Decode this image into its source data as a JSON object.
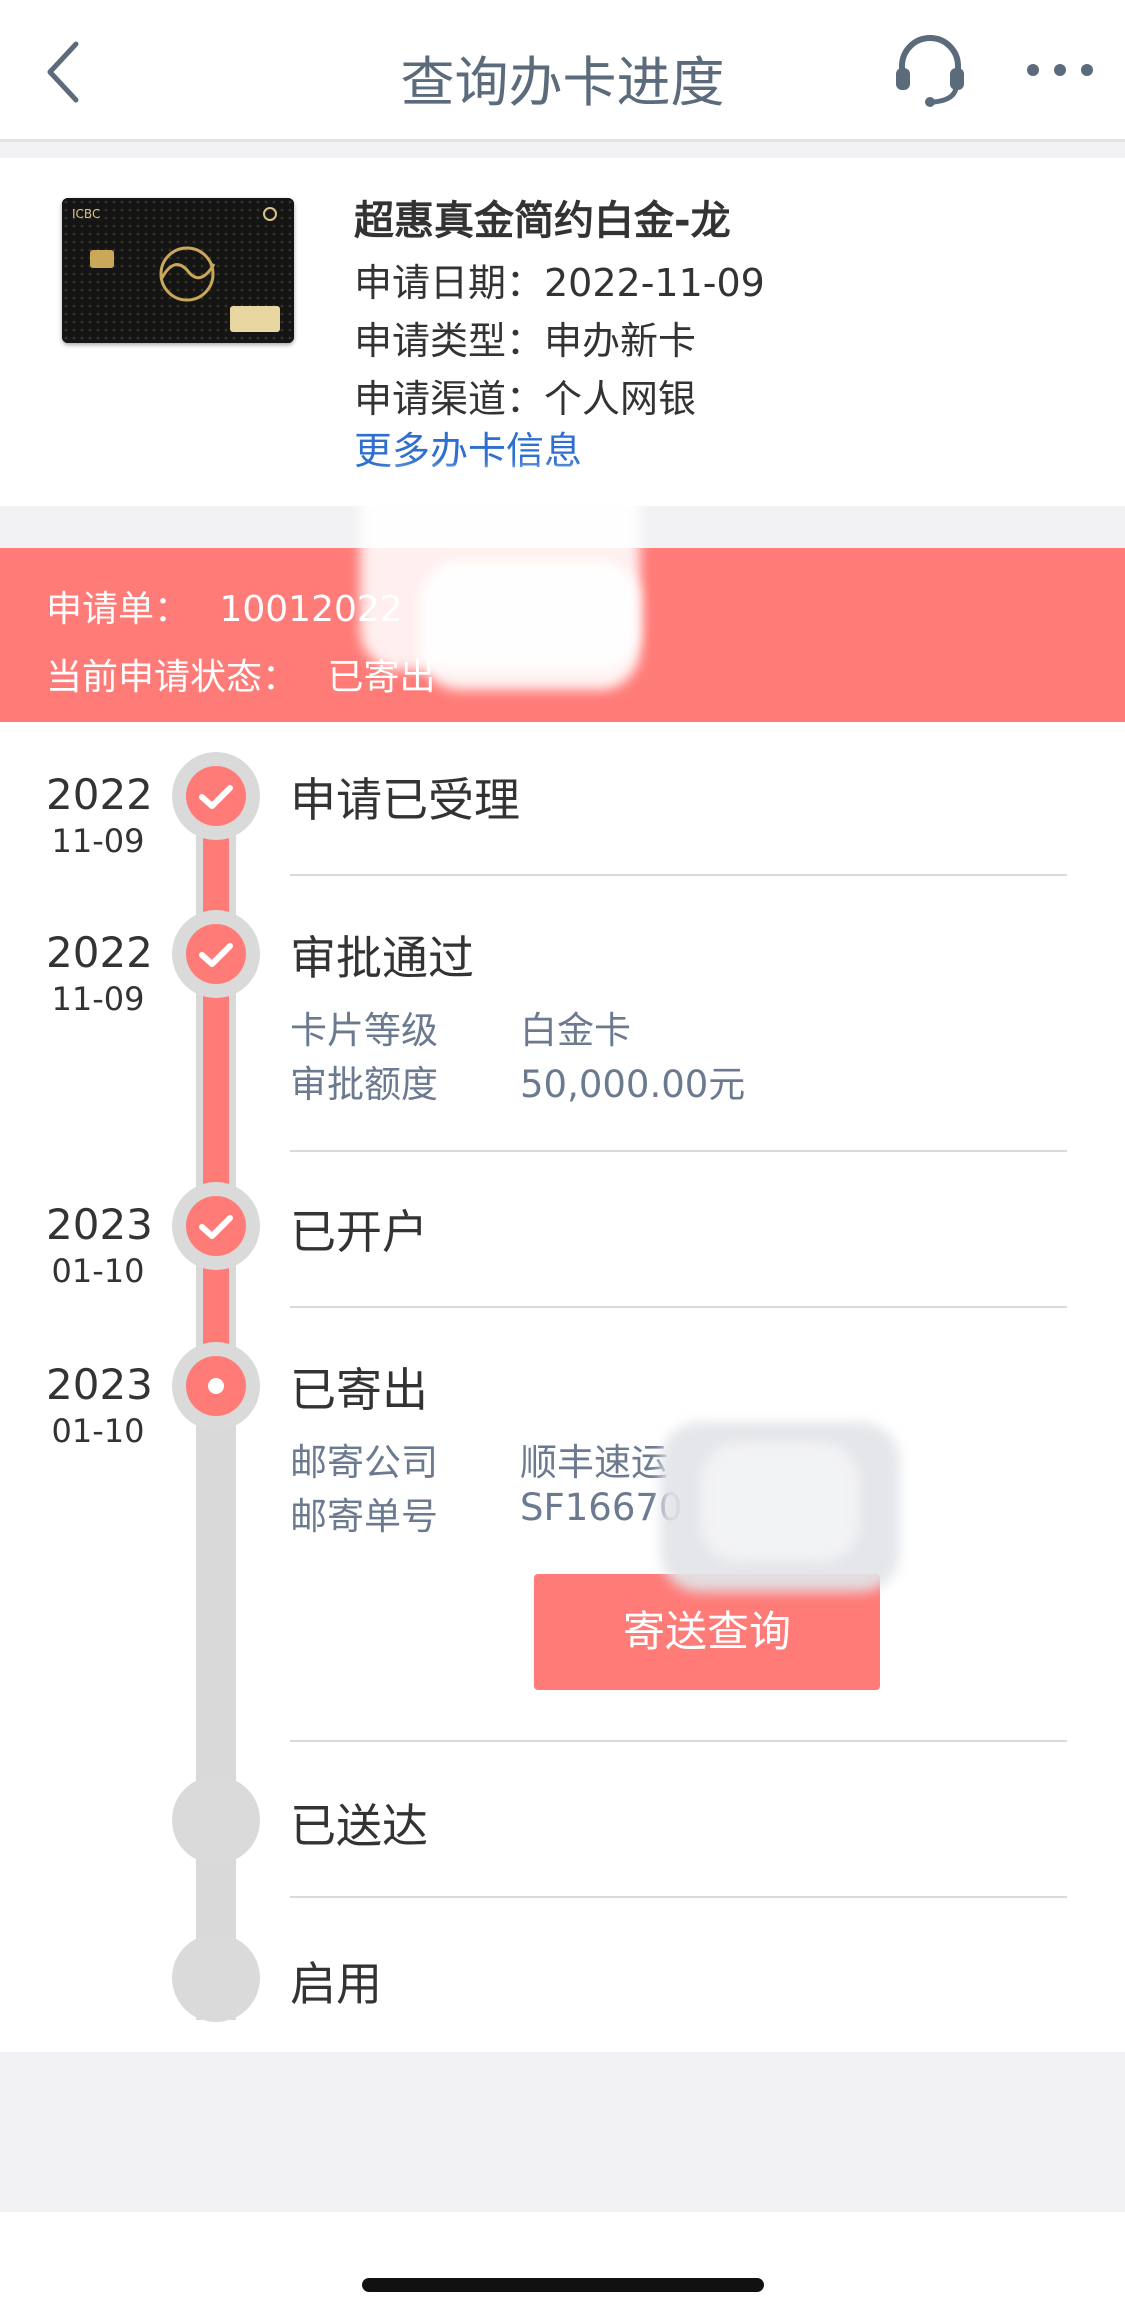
{
  "header": {
    "title": "查询办卡进度",
    "back_icon": "chevron-left-icon",
    "service_icon": "headset-icon",
    "more_icon": "more-dots-icon"
  },
  "card": {
    "name": "超惠真金简约白金-龙",
    "apply_date": "申请日期：2022-11-09",
    "apply_type": "申请类型：申办新卡",
    "apply_channel": "申请渠道：个人网银",
    "more_link": "更多办卡信息",
    "card_brand": "ICBC"
  },
  "banner": {
    "order_label": "申请单：",
    "order_value": "10012022",
    "status_label": "当前申请状态：",
    "status_value": "已寄出"
  },
  "timeline": {
    "steps": [
      {
        "year": "2022",
        "md": "11-09",
        "title": "申请已受理"
      },
      {
        "year": "2022",
        "md": "11-09",
        "title": "审批通过",
        "details": [
          {
            "label": "卡片等级",
            "value": "白金卡"
          },
          {
            "label": "审批额度",
            "value": "50,000.00元"
          }
        ]
      },
      {
        "year": "2023",
        "md": "01-10",
        "title": "已开户"
      },
      {
        "year": "2023",
        "md": "01-10",
        "title": "已寄出",
        "details": [
          {
            "label": "邮寄公司",
            "value": "顺丰速运"
          },
          {
            "label": "邮寄单号",
            "value": "SF16670"
          }
        ],
        "button": "寄送查询"
      },
      {
        "title": "已送达"
      },
      {
        "title": "启用"
      }
    ]
  },
  "colors": {
    "accent": "#ff7b78",
    "link": "#2e6fcf",
    "title": "#5b6b7c",
    "detail": "#6c7a90"
  }
}
